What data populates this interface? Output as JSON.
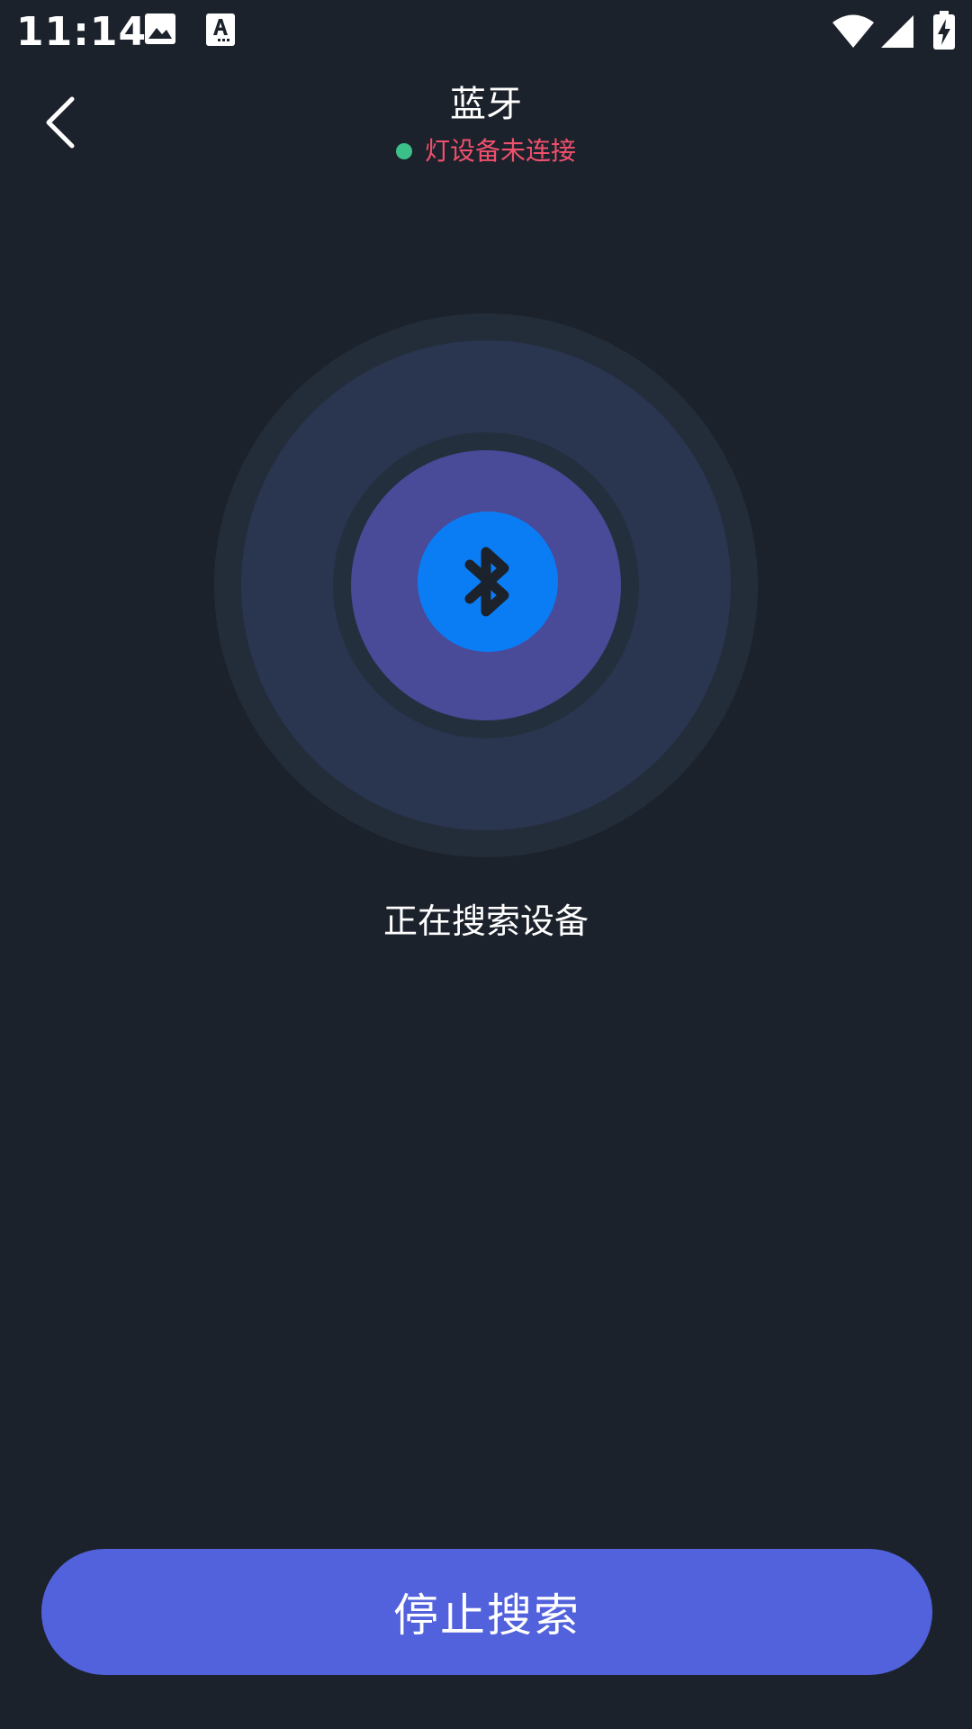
{
  "status_bar": {
    "time": "11:14",
    "icons": [
      "image-notification-icon",
      "text-notification-icon",
      "wifi-icon",
      "signal-icon",
      "battery-charging-icon"
    ]
  },
  "header": {
    "back_icon": "chevron-left-icon",
    "title": "蓝牙",
    "connection_status": "灯设备未连接"
  },
  "radar": {
    "center_icon": "bluetooth-icon"
  },
  "main": {
    "searching_label": "正在搜索设备"
  },
  "footer": {
    "stop_button_label": "停止搜索"
  },
  "colors": {
    "background": "#1c222b",
    "status_dot": "#3cc08a",
    "status_text": "#f0506e",
    "bluetooth_core": "#0a7df5",
    "button": "#5261dc"
  }
}
